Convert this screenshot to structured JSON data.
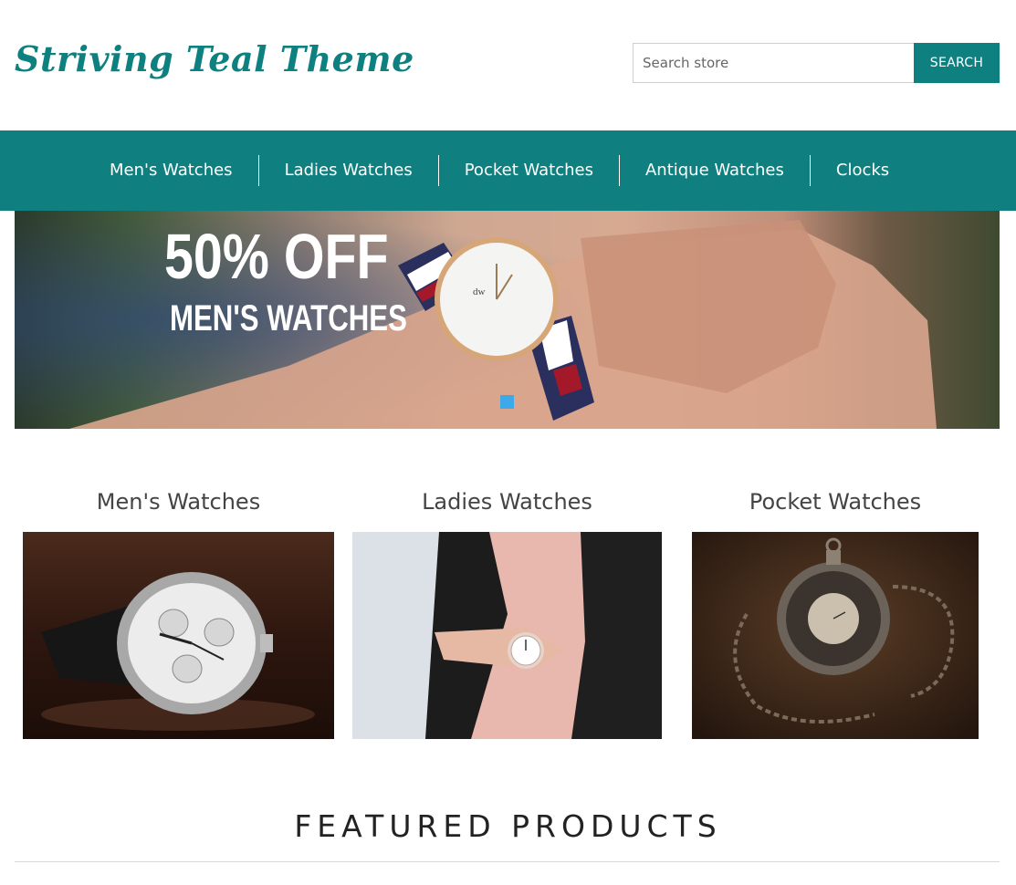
{
  "header": {
    "logo": "Striving Teal Theme",
    "search_placeholder": "Search store",
    "search_button": "SEARCH"
  },
  "nav": {
    "items": [
      {
        "label": "Men's Watches"
      },
      {
        "label": "Ladies Watches"
      },
      {
        "label": "Pocket Watches"
      },
      {
        "label": "Antique Watches"
      },
      {
        "label": "Clocks"
      }
    ]
  },
  "banner": {
    "line1": "50% OFF",
    "line2": "MEN'S WATCHES",
    "slide_count": 1,
    "active_slide": 1
  },
  "categories": [
    {
      "title": "Men's Watches"
    },
    {
      "title": "Ladies Watches"
    },
    {
      "title": "Pocket Watches"
    }
  ],
  "featured": {
    "title": "FEATURED PRODUCTS"
  },
  "colors": {
    "brand_teal": "#0f8080",
    "slider_dot": "#3ea9e8"
  }
}
